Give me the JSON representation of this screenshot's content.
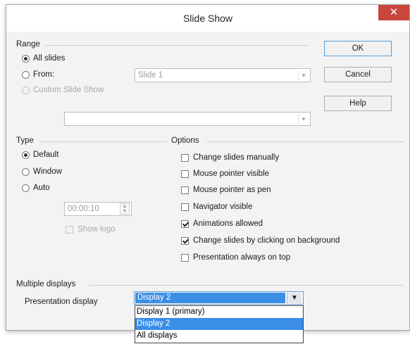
{
  "dialog": {
    "title": "Slide Show",
    "close_glyph": "✕",
    "buttons": {
      "ok": "OK",
      "cancel": "Cancel",
      "help": "Help"
    }
  },
  "range": {
    "label": "Range",
    "all_slides": "All slides",
    "from": "From:",
    "from_value": "Slide 1",
    "custom": "Custom Slide Show",
    "custom_value": "",
    "selected": "all_slides"
  },
  "type": {
    "label": "Type",
    "default": "Default",
    "window": "Window",
    "auto": "Auto",
    "auto_time": "00:00:10",
    "show_logo": "Show logo",
    "selected": "default"
  },
  "options": {
    "label": "Options",
    "items": [
      {
        "label": "Change slides manually",
        "checked": false
      },
      {
        "label": "Mouse pointer visible",
        "checked": false
      },
      {
        "label": "Mouse pointer as pen",
        "checked": false
      },
      {
        "label": "Navigator visible",
        "checked": false
      },
      {
        "label": "Animations allowed",
        "checked": true
      },
      {
        "label": "Change slides by clicking on background",
        "checked": true
      },
      {
        "label": "Presentation always on top",
        "checked": false
      }
    ]
  },
  "displays": {
    "label": "Multiple displays",
    "presentation_display_label": "Presentation display",
    "selected": "Display 2",
    "options": [
      "Display 1 (primary)",
      "Display 2",
      "All displays"
    ]
  },
  "icons": {
    "close": "close-icon",
    "dropdown": "chevron-down-icon",
    "spin": "spin-arrows-icon"
  }
}
